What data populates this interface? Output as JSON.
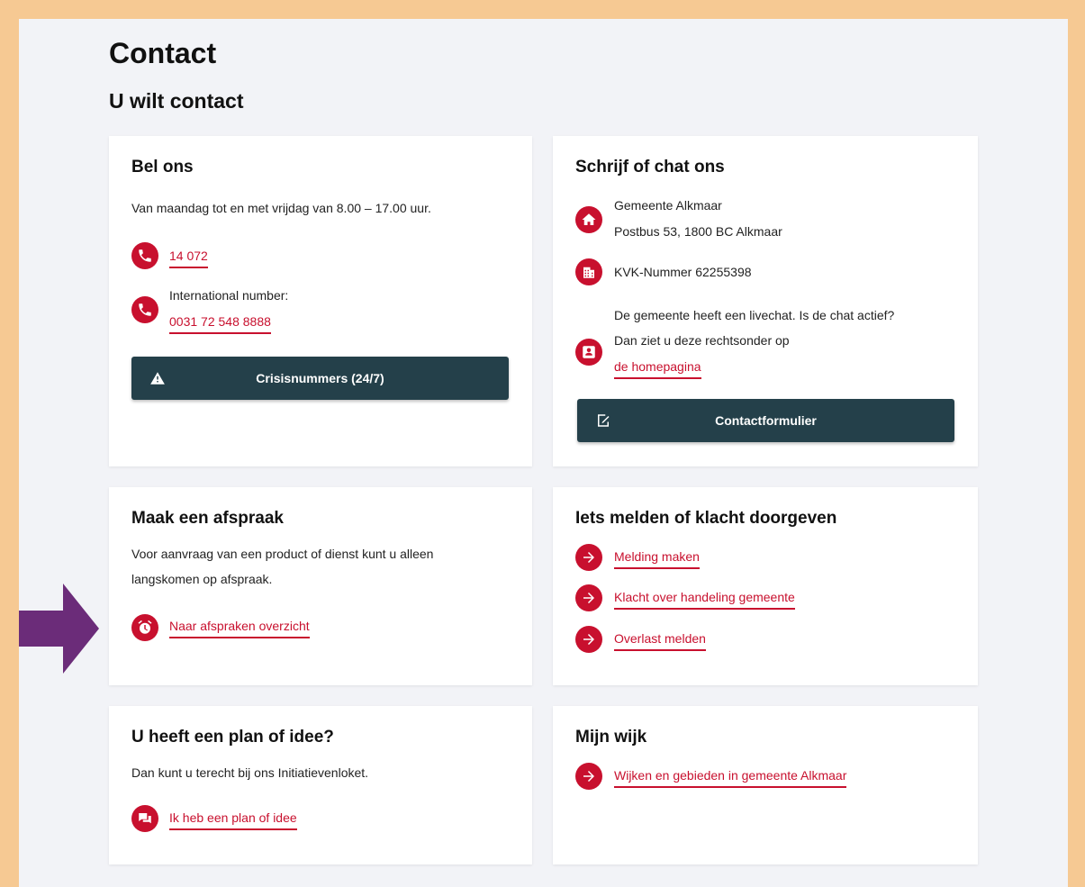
{
  "page": {
    "title": "Contact",
    "section_title": "U wilt contact"
  },
  "bel_ons": {
    "title": "Bel ons",
    "hours": "Van maandag tot en met vrijdag van 8.00 – 17.00 uur.",
    "phone": "14 072",
    "international_label": "International number:",
    "international_phone": "0031 72 548 8888",
    "crisis_button": "Crisisnummers (24/7)"
  },
  "schrijf": {
    "title": "Schrijf of chat ons",
    "address_name": "Gemeente Alkmaar",
    "address_line": "Postbus 53, 1800 BC Alkmaar",
    "kvk": "KVK-Nummer 62255398",
    "chat_line1": "De gemeente heeft een livechat. Is de chat actief?",
    "chat_line2": "Dan ziet u deze rechtsonder op",
    "chat_link": "de homepagina",
    "contact_button": "Contactformulier"
  },
  "afspraak": {
    "title": "Maak een afspraak",
    "text_line1": "Voor aanvraag van een product of dienst kunt u alleen",
    "text_line2": "langskomen op afspraak.",
    "link": "Naar afspraken overzicht"
  },
  "melden": {
    "title": "Iets melden of klacht doorgeven",
    "links": [
      "Melding maken",
      "Klacht over handeling gemeente",
      "Overlast melden"
    ]
  },
  "plan": {
    "title": "U heeft een plan of idee?",
    "text": "Dan kunt u terecht bij ons Initiatievenloket.",
    "link": "Ik heb een plan of idee"
  },
  "wijk": {
    "title": "Mijn wijk",
    "link": "Wijken en gebieden in gemeente Alkmaar"
  },
  "colors": {
    "accent": "#c8102e",
    "button": "#24404a",
    "frame": "#f6c993",
    "annotation_arrow": "#6b2c79"
  }
}
